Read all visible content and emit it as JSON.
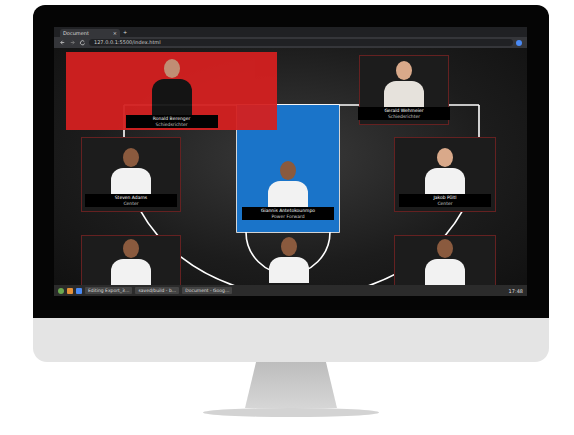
{
  "browser": {
    "tab_title": "Document",
    "tab_close": "×",
    "new_tab": "+",
    "url": "127.0.0.1:5500/index.html"
  },
  "players": [
    {
      "name": "Ronald Berenger",
      "role": "Schiedsrichter",
      "color": "#d42020"
    },
    {
      "name": "Gerald Wehmeier",
      "role": "Schiedsrichter",
      "color": "#1c1c1c"
    },
    {
      "name": "Steven Adams",
      "role": "Center",
      "color": "#1c1c1c"
    },
    {
      "name": "Giannis Antetokounmpo",
      "role": "Power Forward",
      "color": "#1a74c9"
    },
    {
      "name": "Jakob Pöltl",
      "role": "Center",
      "color": "#1c1c1c"
    },
    {
      "color": "#1c1c1c"
    },
    {
      "color": "#1c1c1c"
    },
    {
      "color": "#1c1c1c"
    }
  ],
  "taskbar": {
    "items": [
      "Editing Export_3…",
      "saved/build - b…",
      "Document - Goog…"
    ],
    "time": "17:48"
  }
}
